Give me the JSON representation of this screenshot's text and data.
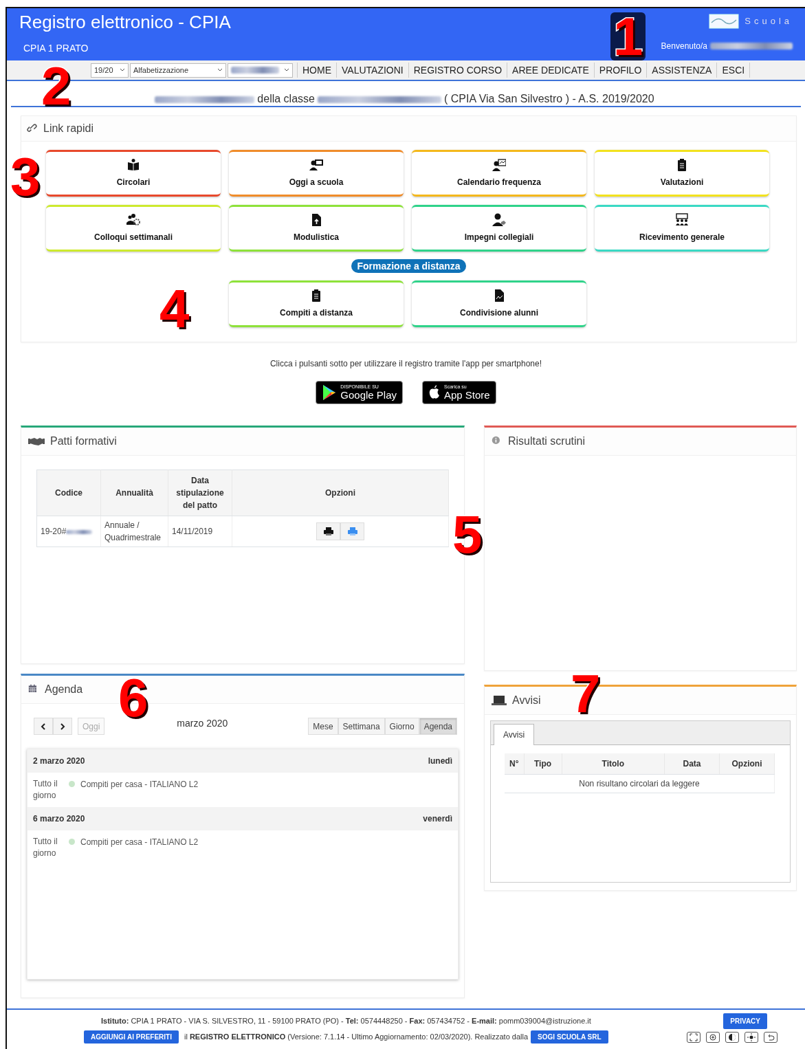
{
  "header": {
    "title": "Registro elettronico - CPIA",
    "school": "CPIA 1 PRATO",
    "logo_text": "Scuola",
    "welcome": "Benvenuto/a"
  },
  "nav": {
    "selects": [
      {
        "kind": "select",
        "value": "19/20"
      },
      {
        "kind": "select",
        "value": "Alfabetizzazione"
      },
      {
        "kind": "redacted"
      }
    ],
    "links": [
      "HOME",
      "VALUTAZIONI",
      "REGISTRO CORSO",
      "AREE DEDICATE",
      "PROFILO",
      "ASSISTENZA",
      "ESCI"
    ]
  },
  "class_line": [
    {
      "kind": "redacted"
    },
    {
      "kind": "text",
      "text": "della classe"
    },
    {
      "kind": "redacted"
    },
    {
      "kind": "text",
      "text": "( CPIA Via San Silvestro ) - A.S. 2019/2020"
    }
  ],
  "quick_links": {
    "title": "Link rapidi",
    "tiles": [
      {
        "label": "Circolari",
        "color": "#e8492c"
      },
      {
        "label": "Oggi a scuola",
        "color": "#f08c2a"
      },
      {
        "label": "Calendario frequenza",
        "color": "#f4b81c"
      },
      {
        "label": "Valutazioni",
        "color": "#f2e21e"
      },
      {
        "label": "Colloqui settimanali",
        "color": "#cdea2e"
      },
      {
        "label": "Modulistica",
        "color": "#8ee23a"
      },
      {
        "label": "Impegni collegiali",
        "color": "#2fd38a"
      },
      {
        "label": "Ricevimento generale",
        "color": "#3ad9c4"
      }
    ],
    "section_badge": "Formazione a distanza",
    "remote_tiles": [
      {
        "label": "Compiti a distanza",
        "color": "#8ee23a"
      },
      {
        "label": "Condivisione alunni",
        "color": "#2fd38a"
      }
    ]
  },
  "apps": {
    "hint": "Clicca i pulsanti sotto per utilizzare il registro tramite l'app per smartphone!",
    "stores": [
      {
        "kind": "google",
        "small": "DISPONIBILE SU",
        "big": "Google Play"
      },
      {
        "kind": "apple",
        "small": "Scarica su",
        "big": "App Store"
      }
    ]
  },
  "patti": {
    "title": "Patti formativi",
    "columns": [
      "Codice",
      "Annualità",
      "Data stipulazione del patto",
      "Opzioni"
    ],
    "rows": [
      {
        "code": "19-20#",
        "period": "Annuale / Quadrimestrale",
        "date": "14/11/2019"
      }
    ]
  },
  "risultati": {
    "title": "Risultati scrutini"
  },
  "agenda": {
    "title": "Agenda",
    "today": "Oggi",
    "month": "marzo 2020",
    "views": [
      {
        "label": "Mese",
        "selected": false
      },
      {
        "label": "Settimana",
        "selected": false
      },
      {
        "label": "Giorno",
        "selected": false
      },
      {
        "label": "Agenda",
        "selected": true
      }
    ],
    "days": [
      {
        "date": "2 marzo 2020",
        "weekday": "lunedì",
        "events": [
          {
            "time": "Tutto il giorno",
            "title": "Compiti per casa - ITALIANO L2",
            "color": "#c8e6c9"
          }
        ]
      },
      {
        "date": "6 marzo 2020",
        "weekday": "venerdì",
        "events": [
          {
            "time": "Tutto il giorno",
            "title": "Compiti per casa - ITALIANO L2",
            "color": "#c8e6c9"
          }
        ]
      }
    ]
  },
  "avvisi": {
    "title": "Avvisi",
    "tabs": [
      {
        "label": "Avvisi",
        "selected": true
      }
    ],
    "columns": [
      "N°",
      "Tipo",
      "Titolo",
      "Data",
      "Opzioni"
    ],
    "empty": "Non risultano circolari da leggere"
  },
  "footer": {
    "address": "**Istituto:** CPIA 1 PRATO - VIA S. SILVESTRO, 11 - 59100 PRATO (PO) - **Tel:** 0574448250 - **Fax:** 057434752 - **E-mail:** pomm039004@istruzione.it",
    "privacy": "PRIVACY",
    "favorites": "AGGIUNGI AI PREFERITI",
    "version": "il **REGISTRO ELETTRONICO** (Versione: 7.1.14 - Ultimo Aggiornamento: 02/03/2020). Realizzato dalla",
    "company": "SOGI SCUOLA SRL"
  },
  "annotations": [
    "1",
    "2",
    "3",
    "4",
    "5",
    "6",
    "7"
  ]
}
